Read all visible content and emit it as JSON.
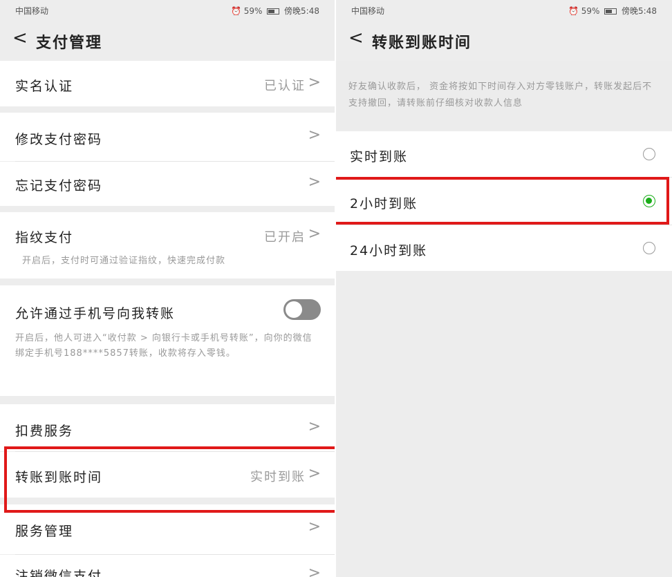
{
  "left": {
    "status": {
      "carrier": "中国移动",
      "time_label": "傍晚5:48",
      "battery": "59%"
    },
    "title": "支付管理",
    "back_glyph": "<",
    "chevron": ">",
    "items": {
      "realname": {
        "label": "实名认证",
        "value": "已认证"
      },
      "change_pwd": {
        "label": "修改支付密码"
      },
      "forgot_pwd": {
        "label": "忘记支付密码"
      },
      "fingerprint": {
        "label": "指纹支付",
        "value": "已开启",
        "sub": "开启后，支付时可通过验证指纹，快速完成付款"
      },
      "phone_transfer": {
        "label": "允许通过手机号向我转账",
        "sub": "开启后，他人可进入“收付款 > 向银行卡或手机号转账”，向你的微信绑定手机号188****5857转账，收款将存入零钱。",
        "enabled": false
      },
      "deduct": {
        "label": "扣费服务"
      },
      "arrival_time": {
        "label": "转账到账时间",
        "value": "实时到账"
      },
      "service_mgmt": {
        "label": "服务管理"
      },
      "cancel_wallet": {
        "label": "注销微信支付"
      }
    }
  },
  "right": {
    "status": {
      "carrier": "中国移动",
      "time_label": "傍晚5:48",
      "battery": "59%"
    },
    "title": "转账到账时间",
    "back_glyph": "<",
    "description": "好友确认收款后， 资金将按如下时间存入对方零钱账户，转账发起后不支持撤回，请转账前仔细核对收款人信息",
    "options": [
      {
        "label": "实时到账",
        "selected": false
      },
      {
        "label": "2小时到账",
        "selected": true
      },
      {
        "label": "24小时到账",
        "selected": false
      }
    ]
  },
  "colors": {
    "highlight": "#e01919",
    "accent_green": "#1aad19",
    "background": "#ededed"
  }
}
